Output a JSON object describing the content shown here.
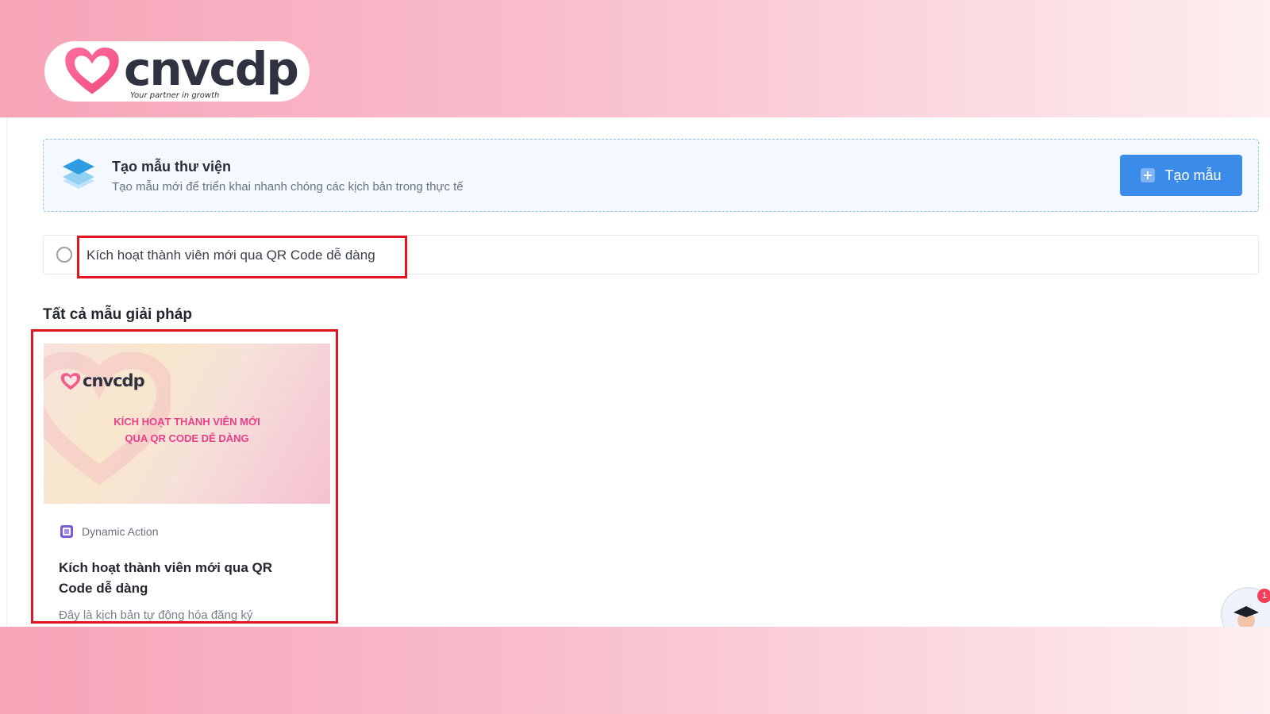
{
  "brand": {
    "name": "cnvcdp",
    "tagline": "Your partner in growth"
  },
  "banner": {
    "title": "Tạo mẫu thư viện",
    "subtitle": "Tạo mẫu mới để triển khai nhanh chóng các kịch bản trong thực tế",
    "create_button": "Tạo mẫu",
    "icon": "layers-icon"
  },
  "search": {
    "value": "Kích hoạt thành viên mới qua QR Code dễ dàng",
    "icon": "search-icon"
  },
  "section": {
    "title": "Tất cả mẫu giải pháp"
  },
  "card": {
    "thumbnail_brand": "cnvcdp",
    "thumbnail_line1": "KÍCH HOẠT THÀNH VIÊN MỚI",
    "thumbnail_line2": "QUA QR CODE DỄ DÀNG",
    "tag": "Dynamic Action",
    "tag_icon": "dynamic-action-icon",
    "title": "Kích hoạt thành viên mới qua QR Code dễ dàng",
    "description": "Đây là kịch bản tự động hóa đăng ký"
  },
  "chat": {
    "badge": "1"
  },
  "colors": {
    "accent": "#3b8beb",
    "highlight": "#e0151f",
    "brand_pink": "#ea3e8b"
  }
}
